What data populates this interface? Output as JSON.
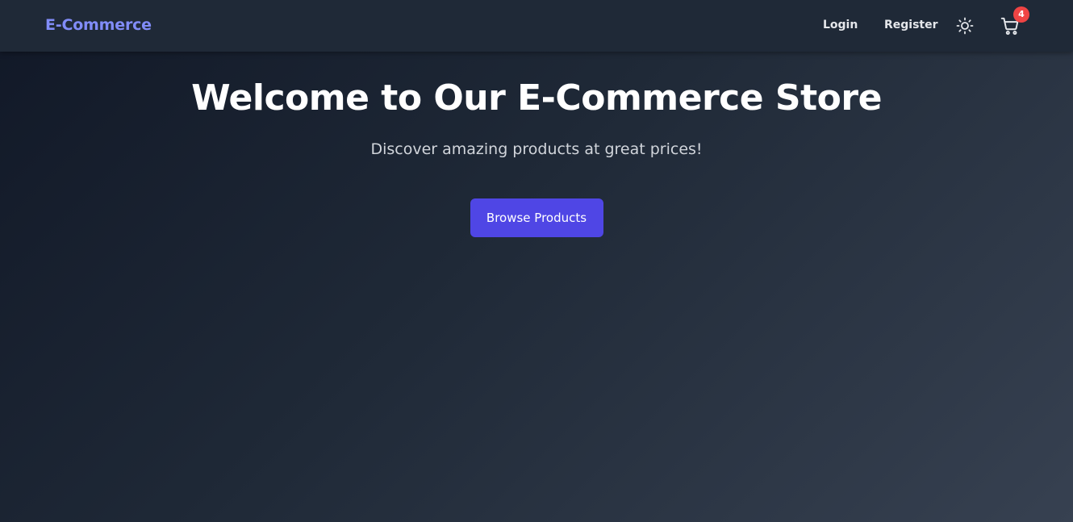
{
  "navbar": {
    "brand": "E-Commerce",
    "login_label": "Login",
    "register_label": "Register",
    "theme_icon": "sun-icon",
    "cart_icon": "cart-icon",
    "cart_count": "4"
  },
  "hero": {
    "title": "Welcome to Our E-Commerce Store",
    "subtitle": "Discover amazing products at great prices!",
    "cta_label": "Browse Products"
  },
  "colors": {
    "brand": "#818cf8",
    "accent": "#4f46e5",
    "badge": "#ef4444",
    "navbar_bg": "#1f2937"
  }
}
